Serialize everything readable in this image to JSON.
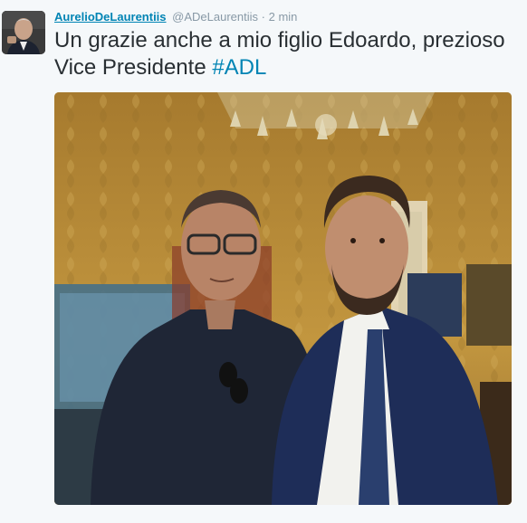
{
  "tweet": {
    "author_fullname": "AurelioDeLaurentiis",
    "author_username": "@ADeLaurentiis",
    "separator": "·",
    "time": "2 min",
    "text_part1": "Un grazie anche a mio figlio Edoardo, prezioso Vice Presidente ",
    "hashtag": "#ADL",
    "media_icon": "photo",
    "avatar_icon": "user-avatar-photo"
  },
  "colors": {
    "link": "#0084b4",
    "meta": "#8899a6",
    "text": "#292f33",
    "background": "#f5f8fa"
  }
}
